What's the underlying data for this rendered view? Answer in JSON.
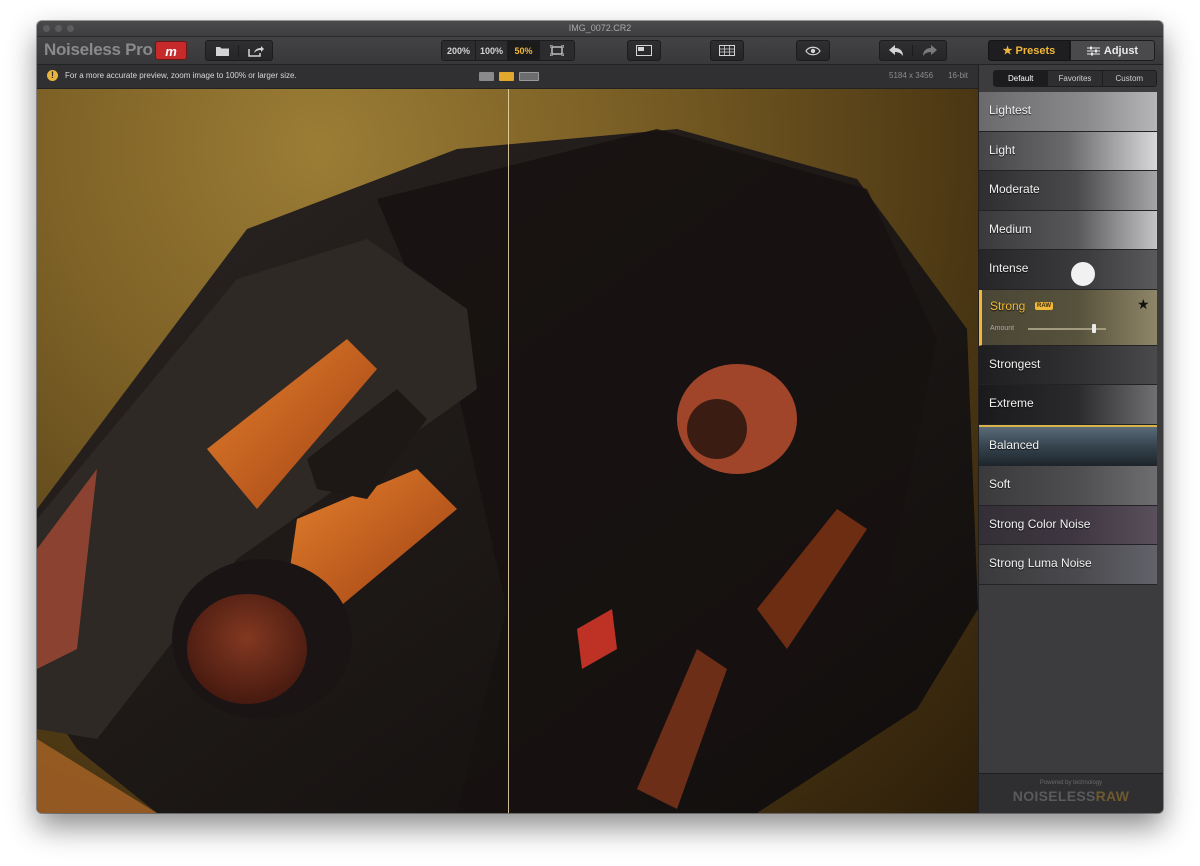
{
  "window": {
    "title": "IMG_0072.CR2"
  },
  "toolbar": {
    "app_name": "Noiseless Pro",
    "app_badge": "m",
    "zoom_options": [
      "200%",
      "100%",
      "50%"
    ],
    "zoom_selected": "50%"
  },
  "infobar": {
    "warning": "For a more accurate preview, zoom image to 100% or larger size.",
    "dimensions": "5184 x 3456",
    "bit_depth": "16-bit"
  },
  "sidebar": {
    "main_tabs": {
      "presets": "Presets",
      "adjust": "Adjust"
    },
    "sub_tabs": [
      "Default",
      "Favorites",
      "Custom"
    ],
    "active_sub_tab": "Default",
    "presets": [
      {
        "label": "Lightest"
      },
      {
        "label": "Light"
      },
      {
        "label": "Moderate"
      },
      {
        "label": "Medium"
      },
      {
        "label": "Intense"
      },
      {
        "label": "Strong",
        "badge": "RAW",
        "amount_label": "Amount",
        "amount": 0.85,
        "favorite": true
      },
      {
        "label": "Strongest"
      },
      {
        "label": "Extreme"
      },
      {
        "label": "Balanced"
      },
      {
        "label": "Soft"
      },
      {
        "label": "Strong Color Noise"
      },
      {
        "label": "Strong Luma Noise"
      }
    ],
    "selected_preset": "Strong",
    "footer": {
      "powered_by": "Powered by technology",
      "logo_main": "NOISELESS",
      "logo_accent": "RAW"
    }
  },
  "photo": {
    "split_position": 0.5
  },
  "colors": {
    "accent": "#f1b73a",
    "brand_red": "#c72a2a"
  }
}
